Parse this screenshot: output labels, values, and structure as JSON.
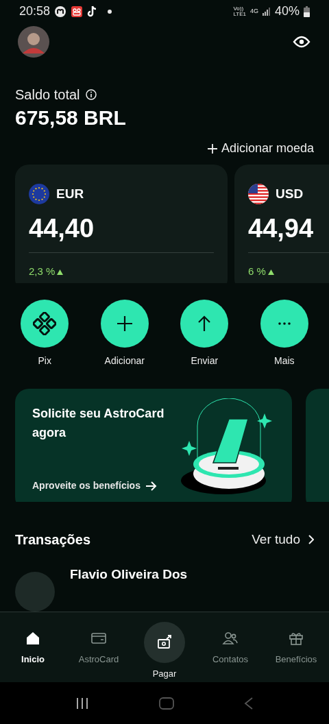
{
  "status_bar": {
    "time": "20:58",
    "voice_label": "Vo))",
    "lte_label": "LTE1",
    "network": "4G",
    "battery": "40%"
  },
  "balance": {
    "label": "Saldo total",
    "amount": "675,58 BRL"
  },
  "add_currency": "Adicionar moeda",
  "accounts": [
    {
      "kind": "eu",
      "currency": "EUR",
      "amount": "44,40",
      "change": "2,3 %"
    },
    {
      "kind": "us",
      "currency": "USD",
      "amount": "44,94",
      "change": "6 %"
    }
  ],
  "actions": [
    {
      "kind": "pix",
      "label": "Pix"
    },
    {
      "kind": "add",
      "label": "Adicionar"
    },
    {
      "kind": "send",
      "label": "Enviar"
    },
    {
      "kind": "more",
      "label": "Mais"
    }
  ],
  "promo": {
    "title": "Solicite seu AstroCard agora",
    "link": "Aproveite os benefícios"
  },
  "transactions": {
    "title": "Transações",
    "see_all": "Ver tudo",
    "items": [
      {
        "name": "Flavio Oliveira Dos"
      }
    ]
  },
  "nav": [
    {
      "kind": "home",
      "label": "Inicio",
      "selected": true
    },
    {
      "kind": "card",
      "label": "AstroCard",
      "selected": false
    },
    {
      "kind": "pay",
      "label": "Pagar",
      "selected": false
    },
    {
      "kind": "contacts",
      "label": "Contatos",
      "selected": false
    },
    {
      "kind": "gift",
      "label": "Benefícios",
      "selected": false
    }
  ]
}
